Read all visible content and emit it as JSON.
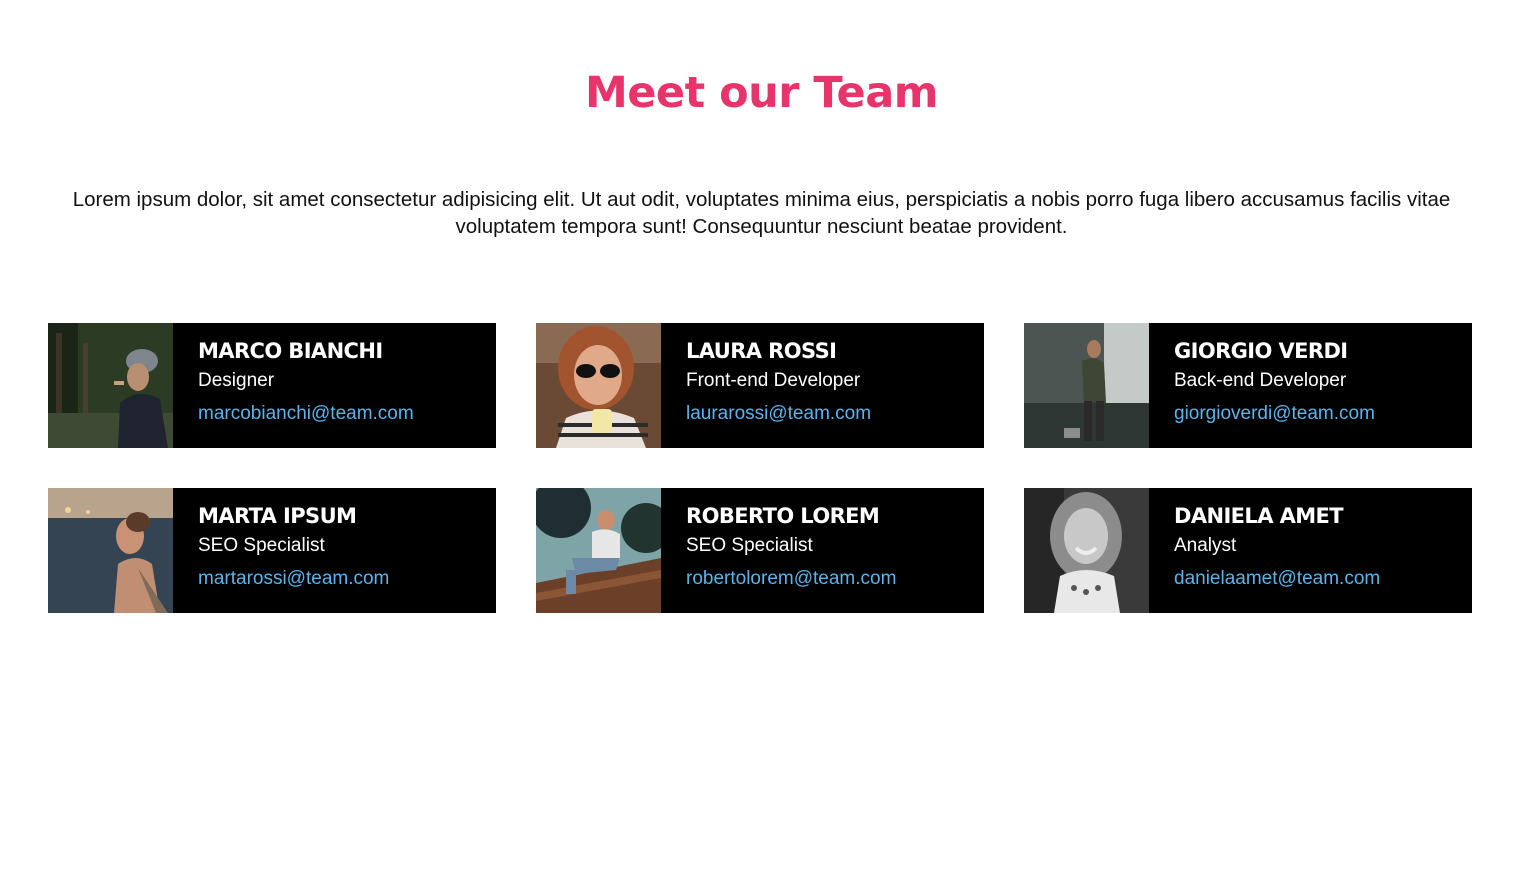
{
  "header": {
    "title": "Meet our Team",
    "intro": "Lorem ipsum dolor, sit amet consectetur adipisicing elit. Ut aut odit, voluptates minima eius, perspiciatis a nobis porro fuga libero accusamus facilis vitae voluptatem tempora sunt! Consequuntur nesciunt beatae provident."
  },
  "colors": {
    "title": "#e8336b",
    "card_bg": "#000000",
    "email": "#5ab4ec"
  },
  "team": [
    {
      "name": "MARCO BIANCHI",
      "role": "Designer",
      "email": "marcobianchi@team.com"
    },
    {
      "name": "LAURA ROSSI",
      "role": "Front-end Developer",
      "email": "laurarossi@team.com"
    },
    {
      "name": "GIORGIO VERDI",
      "role": "Back-end Developer",
      "email": "giorgioverdi@team.com"
    },
    {
      "name": "MARTA IPSUM",
      "role": "SEO Specialist",
      "email": "martarossi@team.com"
    },
    {
      "name": "ROBERTO LOREM",
      "role": "SEO Specialist",
      "email": "robertolorem@team.com"
    },
    {
      "name": "DANIELA AMET",
      "role": "Analyst",
      "email": "danielaamet@team.com"
    }
  ]
}
